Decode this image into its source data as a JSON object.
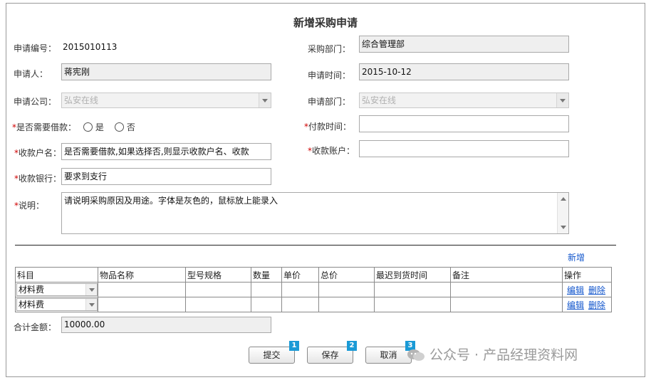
{
  "form": {
    "title": "新增采购申请",
    "apply_no_label": "申请编号：",
    "apply_no_value": "2015010113",
    "purchase_dept_label": "采购部门：",
    "purchase_dept_value": "综合管理部",
    "applicant_label": "申请人：",
    "applicant_value": "蒋宪刚",
    "apply_time_label": "申请时间：",
    "apply_time_value": "2015-10-12",
    "apply_company_label": "申请公司：",
    "apply_company_value": "弘安在线",
    "apply_dept_label": "申请部门：",
    "apply_dept_value": "弘安在线",
    "borrow_label": "是否需要借款：",
    "borrow_yes": "是",
    "borrow_no": "否",
    "pay_time_label": "付款时间：",
    "pay_time_value": "",
    "payee_name_label": "收款户名：",
    "payee_name_value": "是否需要借款,如果选择否,则显示收款户名、收款",
    "payee_account_label": "收款账户：",
    "payee_account_value": "",
    "payee_bank_label": "收款银行：",
    "payee_bank_value": "要求到支行",
    "desc_label": "说明：",
    "desc_value": "请说明采购原因及用途。字体是灰色的，鼠标放上能录入",
    "required_mark": "*"
  },
  "items": {
    "add_link": "新增",
    "headers": [
      "科目",
      "物品名称",
      "型号规格",
      "数量",
      "单价",
      "总价",
      "最迟到货时间",
      "备注",
      "操作"
    ],
    "rows": [
      {
        "subject": "材料费",
        "edit": "编辑",
        "delete": "删除"
      },
      {
        "subject": "材料费",
        "edit": "编辑",
        "delete": "删除"
      }
    ],
    "total_label": "合计金额：",
    "total_value": "10000.00"
  },
  "buttons": {
    "submit": "提交",
    "save": "保存",
    "cancel": "取消",
    "submit_badge": "1",
    "save_badge": "2",
    "cancel_badge": "3"
  },
  "watermark": {
    "text": "公众号 · 产品经理资料网"
  },
  "colors": {
    "link": "#1155cc",
    "required": "#d00000",
    "badge": "#1a9ad6"
  }
}
